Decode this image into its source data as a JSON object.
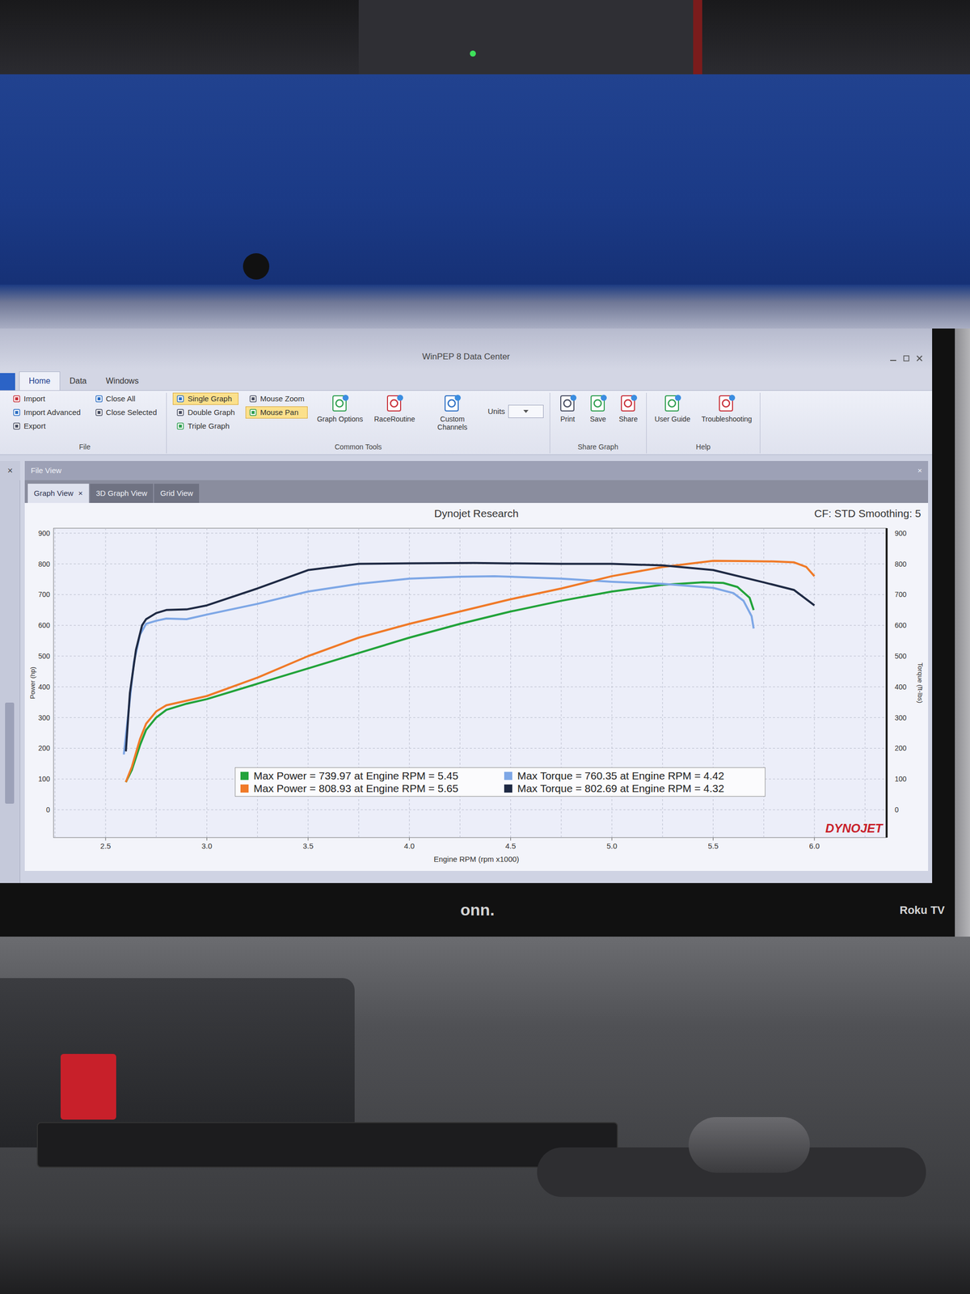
{
  "monitor": {
    "brand": "onn.",
    "model": "Roku TV"
  },
  "window": {
    "title": "WinPEP 8 Data Center"
  },
  "ribbon": {
    "tabs": [
      {
        "label": "Home",
        "selected": true
      },
      {
        "label": "Data",
        "selected": false
      },
      {
        "label": "Windows",
        "selected": false
      }
    ],
    "groups": [
      {
        "label": "File",
        "columns": [
          [
            {
              "label": "Import",
              "kind": "small",
              "selected": false
            },
            {
              "label": "Import Advanced",
              "kind": "small",
              "selected": false
            },
            {
              "label": "Export",
              "kind": "small",
              "selected": false
            }
          ],
          [
            {
              "label": "Close All",
              "kind": "small",
              "selected": false
            },
            {
              "label": "Close Selected",
              "kind": "small",
              "selected": false
            }
          ]
        ]
      },
      {
        "label": "Common Tools",
        "columns": [
          [
            {
              "label": "Single Graph",
              "kind": "small",
              "selected": true
            },
            {
              "label": "Double Graph",
              "kind": "small",
              "selected": false
            },
            {
              "label": "Triple Graph",
              "kind": "small",
              "selected": false
            }
          ],
          [
            {
              "label": "Mouse Zoom",
              "kind": "small",
              "selected": false
            },
            {
              "label": "Mouse Pan",
              "kind": "small",
              "selected": true
            }
          ],
          [
            {
              "label": "Graph Options",
              "kind": "large",
              "selected": false
            }
          ],
          [
            {
              "label": "RaceRoutine",
              "kind": "large",
              "selected": false
            }
          ],
          [
            {
              "label": "Custom Channels",
              "kind": "large",
              "selected": false
            }
          ],
          [
            {
              "label": "Units",
              "kind": "field",
              "selected": false
            }
          ]
        ]
      },
      {
        "label": "Share Graph",
        "columns": [
          [
            {
              "label": "Print",
              "kind": "large",
              "selected": false
            }
          ],
          [
            {
              "label": "Save",
              "kind": "large",
              "selected": false
            }
          ],
          [
            {
              "label": "Share",
              "kind": "large",
              "selected": false
            }
          ]
        ]
      },
      {
        "label": "Help",
        "columns": [
          [
            {
              "label": "User Guide",
              "kind": "large",
              "selected": false
            }
          ],
          [
            {
              "label": "Troubleshooting",
              "kind": "large",
              "selected": false
            }
          ]
        ]
      }
    ]
  },
  "file_view": {
    "title": "File View",
    "close": "×",
    "side_close": "×",
    "tabs": [
      {
        "label": "Graph View",
        "selected": true,
        "close": "×"
      },
      {
        "label": "3D Graph View",
        "selected": false
      },
      {
        "label": "Grid View",
        "selected": false
      }
    ]
  },
  "chart": {
    "title": "Dynojet Research",
    "info": "CF: STD Smoothing: 5",
    "y_left_label": "Power (hp)",
    "y_right_label": "Torque (ft-lbs)",
    "x_label": "Engine RPM (rpm x1000)",
    "y_left_ticks": [
      "0",
      "100",
      "200",
      "300",
      "400",
      "500",
      "600",
      "700",
      "800",
      "900"
    ],
    "y_right_ticks": [
      "0",
      "100",
      "200",
      "300",
      "400",
      "500",
      "600",
      "700",
      "800",
      "900"
    ],
    "x_ticks": [
      "2.5",
      "3.0",
      "3.5",
      "4.0",
      "4.5",
      "5.0",
      "5.5",
      "6.0"
    ],
    "logo": "DYNOJET",
    "series": [
      {
        "legend": "Max Power = 739.97 at Engine RPM = 5.45",
        "color": "#22a33a",
        "rpm": [
          2.6,
          2.63,
          2.67,
          2.7,
          2.75,
          2.8,
          2.9,
          3.0,
          3.25,
          3.5,
          3.75,
          4.0,
          4.25,
          4.5,
          4.75,
          5.0,
          5.25,
          5.45,
          5.55,
          5.62,
          5.68,
          5.7
        ],
        "values": [
          90,
          130,
          210,
          260,
          300,
          325,
          345,
          360,
          410,
          460,
          510,
          560,
          605,
          645,
          680,
          710,
          732,
          740,
          738,
          725,
          690,
          650
        ]
      },
      {
        "legend": "Max Torque = 760.35 at Engine RPM = 4.42",
        "color": "#7ea7e6",
        "rpm": [
          2.59,
          2.61,
          2.64,
          2.67,
          2.7,
          2.75,
          2.8,
          2.9,
          3.0,
          3.25,
          3.5,
          3.75,
          4.0,
          4.25,
          4.42,
          4.75,
          5.0,
          5.25,
          5.5,
          5.6,
          5.65,
          5.69,
          5.7
        ],
        "values": [
          180,
          300,
          480,
          570,
          605,
          615,
          622,
          620,
          635,
          670,
          710,
          735,
          752,
          758,
          760,
          752,
          742,
          735,
          722,
          705,
          680,
          630,
          590
        ]
      },
      {
        "legend": "Max Power = 808.93 at Engine RPM = 5.65",
        "color": "#f07a28",
        "rpm": [
          2.6,
          2.63,
          2.67,
          2.7,
          2.75,
          2.8,
          2.9,
          3.0,
          3.25,
          3.5,
          3.75,
          4.0,
          4.25,
          4.5,
          4.75,
          5.0,
          5.25,
          5.5,
          5.65,
          5.8,
          5.9,
          5.96,
          6.0
        ],
        "values": [
          90,
          140,
          230,
          280,
          320,
          340,
          355,
          370,
          430,
          500,
          560,
          605,
          645,
          685,
          720,
          760,
          790,
          810,
          809,
          808,
          805,
          790,
          760
        ]
      },
      {
        "legend": "Max Torque = 802.69 at Engine RPM = 4.32",
        "color": "#1f2a44",
        "rpm": [
          2.6,
          2.62,
          2.65,
          2.68,
          2.7,
          2.75,
          2.8,
          2.9,
          3.0,
          3.25,
          3.5,
          3.75,
          4.0,
          4.32,
          4.75,
          5.0,
          5.25,
          5.5,
          5.75,
          5.9,
          6.0
        ],
        "values": [
          190,
          380,
          520,
          600,
          620,
          640,
          650,
          652,
          665,
          720,
          780,
          800,
          802,
          803,
          800,
          800,
          795,
          780,
          740,
          715,
          665
        ]
      }
    ]
  }
}
